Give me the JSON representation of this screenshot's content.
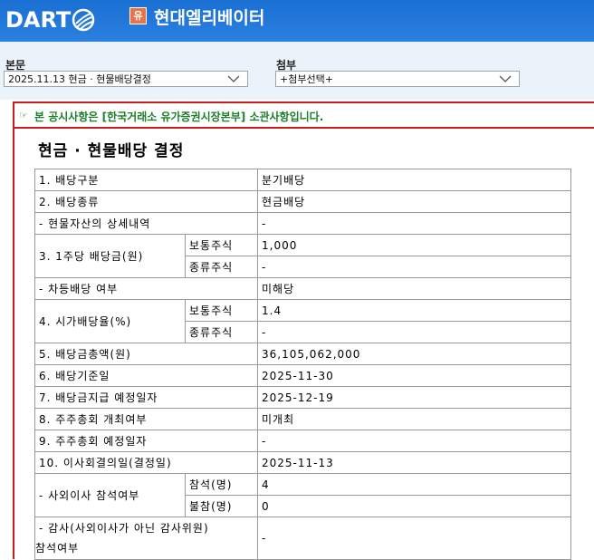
{
  "header": {
    "logo_text": "DART",
    "company_badge": "유",
    "company_name": "현대엘리베이터"
  },
  "controls": {
    "body_label": "본문",
    "body_value": "2025.11.13  현금 · 현물배당결정",
    "attach_label": "첨부",
    "attach_value": "+첨부선택+"
  },
  "notice": {
    "text": "본 공시사항은 [한국거래소 유가증권시장본부] 소관사항입니다."
  },
  "document": {
    "title": "현금 · 현물배당 결정",
    "rows": {
      "r1_label": "1. 배당구분",
      "r1_value": "분기배당",
      "r2_label": "2. 배당종류",
      "r2_value": "현금배당",
      "r3_label": "- 현물자산의 상세내역",
      "r3_value": "-",
      "r4_label": "3. 1주당 배당금(원)",
      "r4_sub1": "보통주식",
      "r4_val1": "1,000",
      "r4_sub2": "종류주식",
      "r4_val2": "-",
      "r5_label": "- 차등배당 여부",
      "r5_value": "미해당",
      "r6_label": "4. 시가배당율(%)",
      "r6_sub1": "보통주식",
      "r6_val1": "1.4",
      "r6_sub2": "종류주식",
      "r6_val2": "-",
      "r7_label": "5. 배당금총액(원)",
      "r7_value": "36,105,062,000",
      "r8_label": "6. 배당기준일",
      "r8_value": "2025-11-30",
      "r9_label": "7. 배당금지급 예정일자",
      "r9_value": "2025-12-19",
      "r10_label": "8. 주주총회 개최여부",
      "r10_value": "미개최",
      "r11_label": "9. 주주총회 예정일자",
      "r11_value": "-",
      "r12_label": "10. 이사회결의일(결정일)",
      "r12_value": "2025-11-13",
      "r13_label": "- 사외이사 참석여부",
      "r13_sub1": "참석(명)",
      "r13_val1": "4",
      "r13_sub2": "불참(명)",
      "r13_val2": "0",
      "r14_label_l1": "- 감사(사외이사가 아닌 감사위원)",
      "r14_label_l2": "참석여부",
      "r14_value": "-"
    }
  }
}
